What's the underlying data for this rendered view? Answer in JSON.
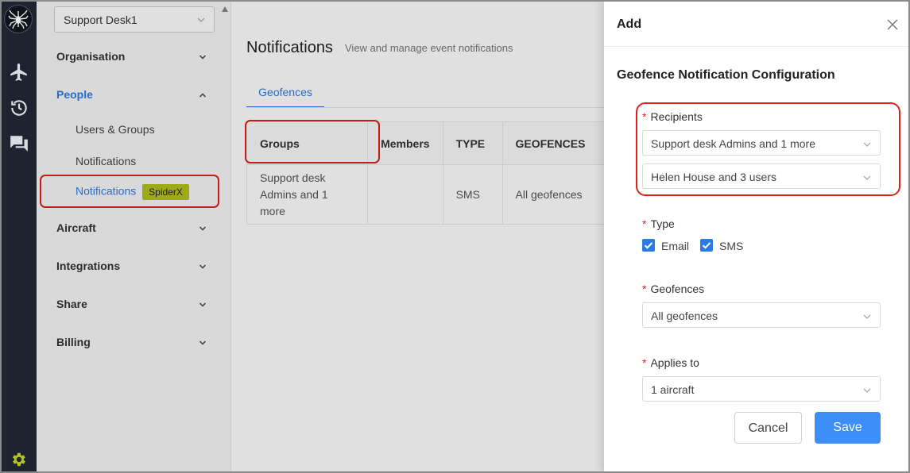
{
  "sidebar": {
    "org_select": "Support Desk1",
    "nav": [
      {
        "label": "Organisation"
      },
      {
        "label": "People"
      },
      {
        "label": "Aircraft"
      },
      {
        "label": "Integrations"
      },
      {
        "label": "Share"
      },
      {
        "label": "Billing"
      }
    ],
    "people_sub": [
      {
        "label": "Users & Groups"
      },
      {
        "label": "Notifications"
      },
      {
        "label": "Notifications",
        "badge": "SpiderX"
      }
    ]
  },
  "main": {
    "title": "Notifications",
    "subtitle": "View and manage event notifications",
    "tab": "Geofences",
    "table": {
      "headers": [
        "Groups",
        "Members",
        "TYPE",
        "GEOFENCES"
      ],
      "row": [
        "Support desk Admins and 1 more",
        "",
        "SMS",
        "All geofences"
      ]
    }
  },
  "drawer": {
    "title": "Add",
    "section_title": "Geofence Notification Configuration",
    "recipients_label": "Recipients",
    "recipients_value_1": "Support desk Admins and 1 more",
    "recipients_value_2": "Helen House and 3 users",
    "type_label": "Type",
    "type_email": "Email",
    "type_sms": "SMS",
    "geofences_label": "Geofences",
    "geofences_value": "All geofences",
    "applies_label": "Applies to",
    "applies_value": "1 aircraft",
    "cancel": "Cancel",
    "save": "Save"
  },
  "colors": {
    "accent": "#2c7be5",
    "highlight": "#e0201b",
    "badge": "#b5c21b",
    "rail": "#1d2430"
  },
  "icons": [
    "spider-logo-icon",
    "airplane-icon",
    "history-icon",
    "chat-icon",
    "settings-icon",
    "chevron-down-icon",
    "chevron-up-icon",
    "close-icon",
    "checkbox-checked-icon"
  ]
}
